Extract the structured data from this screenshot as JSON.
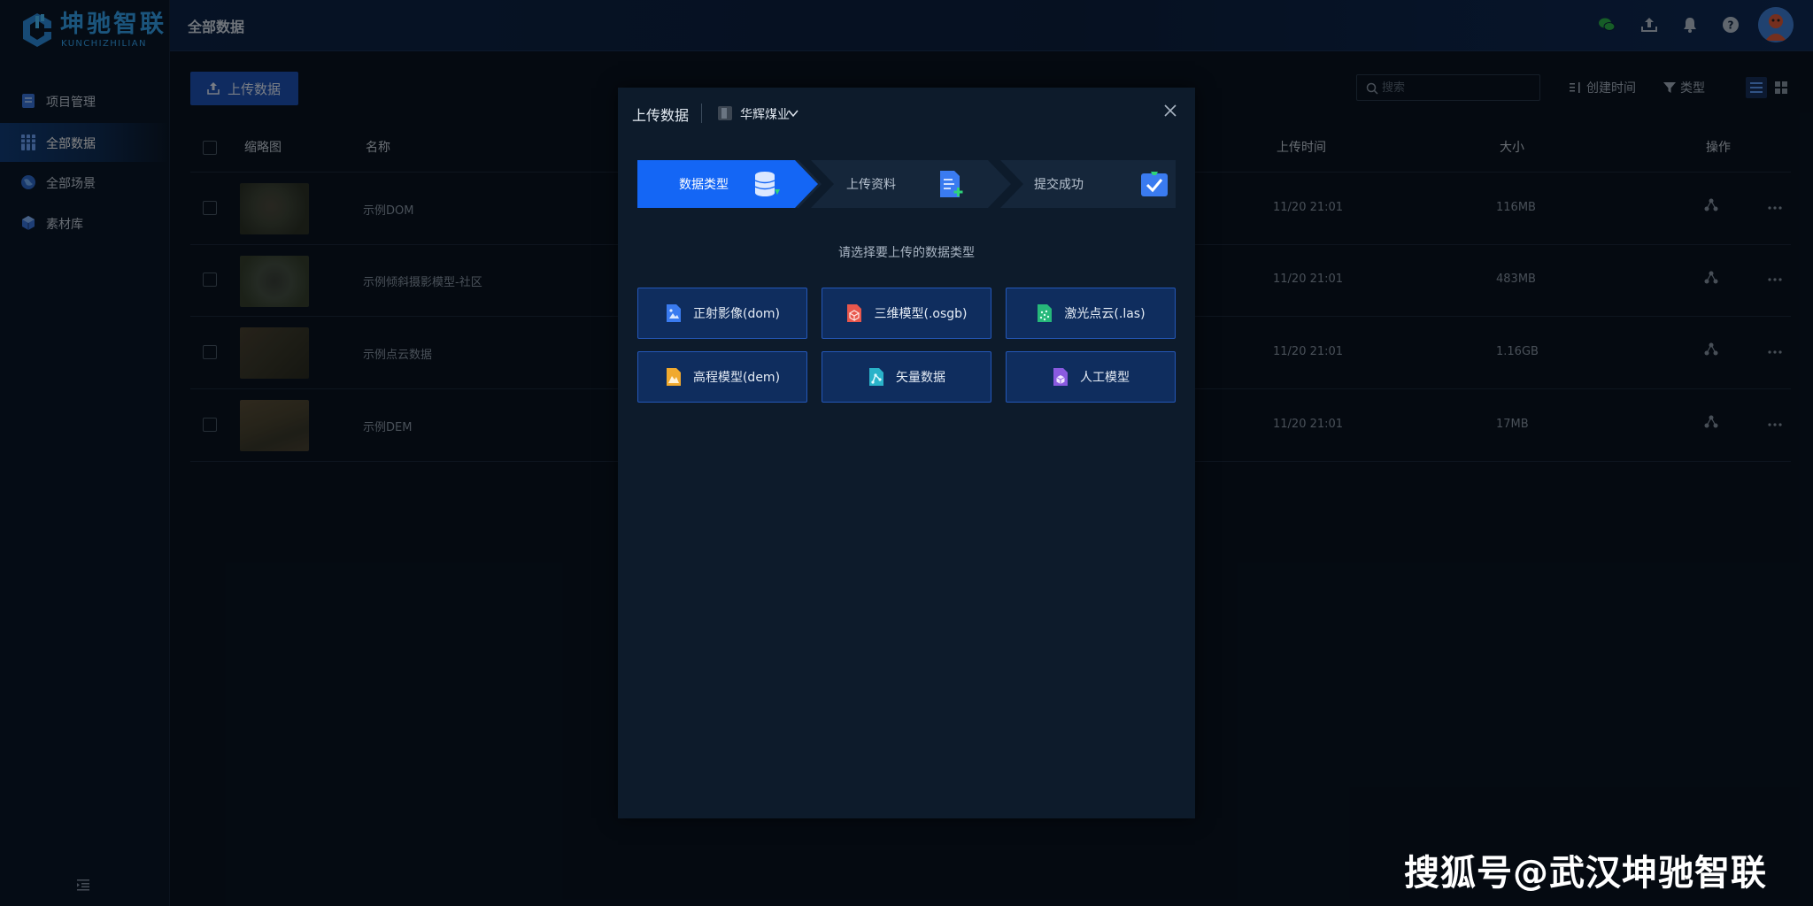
{
  "brand": {
    "name": "坤驰智联",
    "subtitle": "KUNCHIZHILIAN"
  },
  "sidebar": {
    "items": [
      {
        "label": "项目管理",
        "icon": "project-icon"
      },
      {
        "label": "全部数据",
        "icon": "data-icon",
        "active": true
      },
      {
        "label": "全部场景",
        "icon": "globe-icon"
      },
      {
        "label": "素材库",
        "icon": "cube-icon"
      }
    ]
  },
  "header": {
    "title": "全部数据"
  },
  "toolbar": {
    "upload_label": "上传数据",
    "search_placeholder": "搜索",
    "sort_label": "创建时间",
    "filter_label": "类型"
  },
  "table": {
    "columns": [
      "缩略图",
      "名称",
      "上传时间",
      "大小",
      "操作"
    ],
    "rows": [
      {
        "name": "示例DOM",
        "time": "11/20 21:01",
        "size": "116MB"
      },
      {
        "name": "示例倾斜摄影模型-社区",
        "time": "11/20 21:01",
        "size": "483MB"
      },
      {
        "name": "示例点云数据",
        "time": "11/20 21:01",
        "size": "1.16GB"
      },
      {
        "name": "示例DEM",
        "time": "11/20 21:01",
        "size": "17MB"
      }
    ]
  },
  "modal": {
    "title": "上传数据",
    "project": "华辉煤业",
    "steps": [
      "数据类型",
      "上传资料",
      "提交成功"
    ],
    "prompt": "请选择要上传的数据类型",
    "types": [
      {
        "label": "正射影像(dom)",
        "color": "#3a7bf0"
      },
      {
        "label": "三维模型(.osgb)",
        "color": "#e8574c"
      },
      {
        "label": "激光点云(.las)",
        "color": "#26b87a"
      },
      {
        "label": "高程模型(dem)",
        "color": "#f0a92e"
      },
      {
        "label": "矢量数据",
        "color": "#2ab3c9"
      },
      {
        "label": "人工模型",
        "color": "#8a5ae0"
      }
    ]
  },
  "colors": {
    "accent": "#1466f5",
    "primary_button": "#1e54b8",
    "background": "#0a1522"
  },
  "watermark": "搜狐号@武汉坤驰智联"
}
